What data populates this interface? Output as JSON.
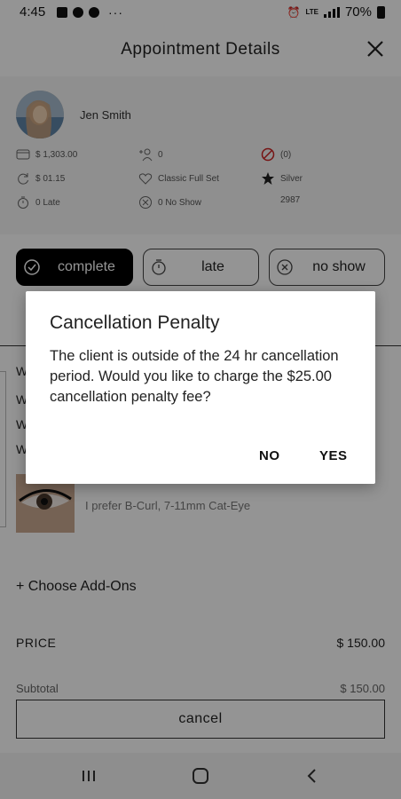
{
  "status_bar": {
    "time": "4:45",
    "dots": "···",
    "battery": "70%",
    "network": "LTE"
  },
  "header": {
    "title": "Appointment Details"
  },
  "client": {
    "name": "Jen Smith",
    "stats": [
      {
        "icon": "credit-card-icon",
        "value": "$ 1,303.00"
      },
      {
        "icon": "add-person-icon",
        "value": "0"
      },
      {
        "icon": "no-entry-icon",
        "value": "(0)"
      },
      {
        "icon": "refresh-icon",
        "value": "$ 01.15"
      },
      {
        "icon": "heart-icon",
        "value": "Classic Full Set"
      },
      {
        "icon": "star-icon",
        "value": "Silver"
      },
      {
        "icon": "stopwatch-icon",
        "value": "0 Late"
      },
      {
        "icon": "cancel-circle-icon",
        "value": "0 No Show"
      },
      {
        "icon": "",
        "value": "2987"
      }
    ]
  },
  "status_buttons": {
    "complete": "complete",
    "late": "late",
    "no_show": "no show"
  },
  "section": {
    "w_letters": [
      "W",
      "W",
      "W",
      "W"
    ],
    "lash_note": "I prefer B-Curl, 7-11mm Cat-Eye"
  },
  "addons": {
    "label": "+ Choose Add-Ons"
  },
  "price": {
    "label": "PRICE",
    "value": "$ 150.00"
  },
  "subtotal": {
    "label": "Subtotal",
    "value": "$ 150.00"
  },
  "cancel_button": {
    "label": "cancel"
  },
  "dialog": {
    "title": "Cancellation Penalty",
    "message": "The client is outside of the 24 hr cancellation period. Would you like to charge the $25.00 cancellation penalty fee?",
    "no_label": "NO",
    "yes_label": "YES"
  }
}
